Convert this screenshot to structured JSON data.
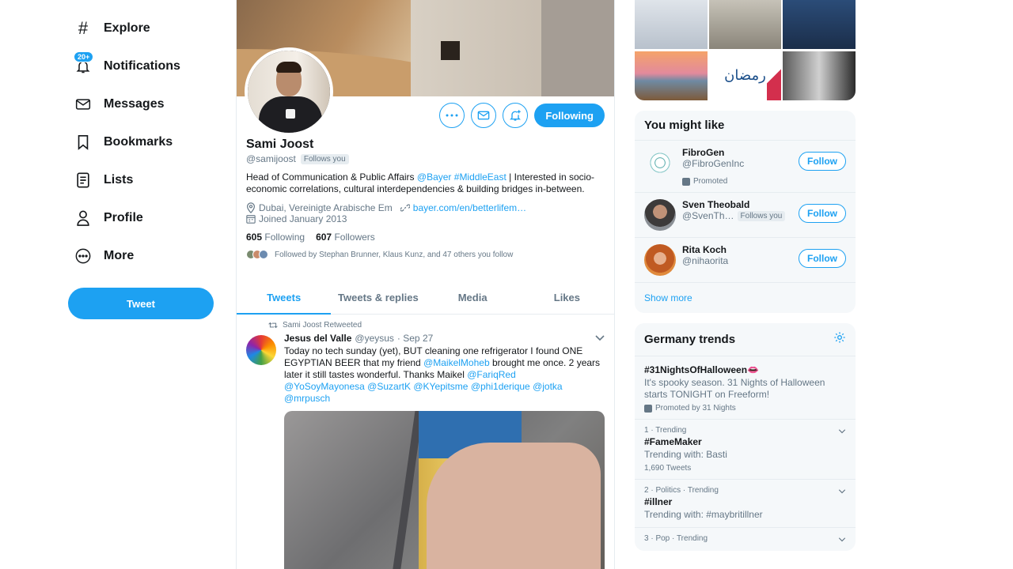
{
  "nav": {
    "items": [
      {
        "label": "Explore",
        "icon": "hash-icon"
      },
      {
        "label": "Notifications",
        "icon": "bell-icon",
        "badge": "20+"
      },
      {
        "label": "Messages",
        "icon": "envelope-icon"
      },
      {
        "label": "Bookmarks",
        "icon": "bookmark-icon"
      },
      {
        "label": "Lists",
        "icon": "list-icon"
      },
      {
        "label": "Profile",
        "icon": "person-icon"
      },
      {
        "label": "More",
        "icon": "more-circle-icon"
      }
    ],
    "tweet_button": "Tweet"
  },
  "profile": {
    "name": "Sami Joost",
    "handle": "@samijoost",
    "follows_you": "Follows you",
    "following_button": "Following",
    "bio_pre": "Head of Communication & Public Affairs ",
    "bio_mention": "@Bayer",
    "bio_hashtag": "#MiddleEast",
    "bio_post": " | Interested in socio-economic correlations, cultural interdependencies & building bridges in-between.",
    "location": "Dubai, Vereinigte Arabische Em",
    "website": "bayer.com/en/betterlifem…",
    "joined": "Joined January 2013",
    "following_count": "605",
    "following_label": "Following",
    "followers_count": "607",
    "followers_label": "Followers",
    "followed_by": "Followed by Stephan Brunner, Klaus Kunz, and 47 others you follow"
  },
  "tabs": [
    "Tweets",
    "Tweets & replies",
    "Media",
    "Likes"
  ],
  "tweet": {
    "retweeted_by": "Sami Joost Retweeted",
    "author": "Jesus del Valle",
    "handle": "@yeysus",
    "date": "· Sep 27",
    "text_1": "Today no tech sunday (yet), BUT cleaning one refrigerator I found ONE EGYPTIAN BEER that my friend ",
    "mention_1": "@MaikelMoheb",
    "text_2": " brought me once. 2 years later it still tastes wonderful. Thanks Maikel ",
    "mention_2": "@FariqRed",
    "mention_3": "@YoSoyMayonesa",
    "mention_4": "@SuzartK",
    "mention_5": "@KYepitsme",
    "mention_6": "@phi1derique",
    "mention_7": "@jotka",
    "mention_8": "@mrpusch"
  },
  "who_to_follow": {
    "title": "You might like",
    "follow_label": "Follow",
    "accounts": [
      {
        "name": "FibroGen",
        "handle": "@FibroGenInc",
        "promoted": "Promoted"
      },
      {
        "name": "Sven Theobald",
        "handle": "@SvenTh…",
        "follows_you": "Follows you"
      },
      {
        "name": "Rita Koch",
        "handle": "@nihaorita"
      }
    ],
    "show_more": "Show more"
  },
  "trends": {
    "title": "Germany trends",
    "items": [
      {
        "name": "#31NightsOfHalloween",
        "emoji": "👄",
        "desc": "It's spooky season. 31 Nights of Halloween starts TONIGHT on Freeform!",
        "meta": "Promoted by 31 Nights"
      },
      {
        "context": "1 · Trending",
        "name": "#FameMaker",
        "desc": "Trending with: Basti",
        "meta": "1,690 Tweets"
      },
      {
        "context": "2 · Politics · Trending",
        "name": "#illner",
        "desc": "Trending with: #maybritillner"
      },
      {
        "context": "3 · Pop · Trending",
        "name": ""
      }
    ]
  },
  "photo_grid_text": "رمضان",
  "colors": {
    "accent": "#1da1f2",
    "text": "#14171a",
    "muted": "#657786",
    "panel": "#f5f8fa"
  }
}
